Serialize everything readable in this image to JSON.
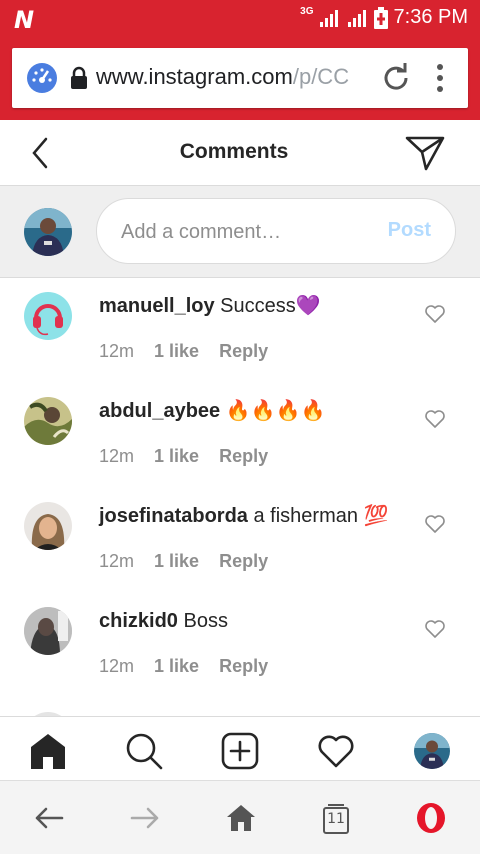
{
  "status_bar": {
    "network": "3G",
    "time": "7:36 PM"
  },
  "browser": {
    "url_main": "www.instagram.com",
    "url_faded": "/p/CC",
    "tab_count": "11",
    "icons": [
      "speed-dial-icon",
      "lock-icon",
      "reload-icon",
      "menu-dots-icon"
    ]
  },
  "header": {
    "title": "Comments"
  },
  "composer": {
    "placeholder": "Add a comment…",
    "post_label": "Post"
  },
  "comments": [
    {
      "username": "manuell_loy",
      "text": "Success💜",
      "time": "12m",
      "likes": "1 like",
      "reply": "Reply"
    },
    {
      "username": "abdul_aybee",
      "text": "🔥🔥🔥🔥",
      "time": "12m",
      "likes": "1 like",
      "reply": "Reply"
    },
    {
      "username": "josefinataborda",
      "text": "a fisherman 💯",
      "time": "12m",
      "likes": "1 like",
      "reply": "Reply"
    },
    {
      "username": "chizkid0",
      "text": "Boss",
      "time": "12m",
      "likes": "1 like",
      "reply": "Reply"
    }
  ],
  "colors": {
    "browser_red": "#d8232f",
    "post_disabled": "#b3dbff",
    "meta_gray": "#8e8e8e",
    "opera_red": "#e5162a"
  }
}
